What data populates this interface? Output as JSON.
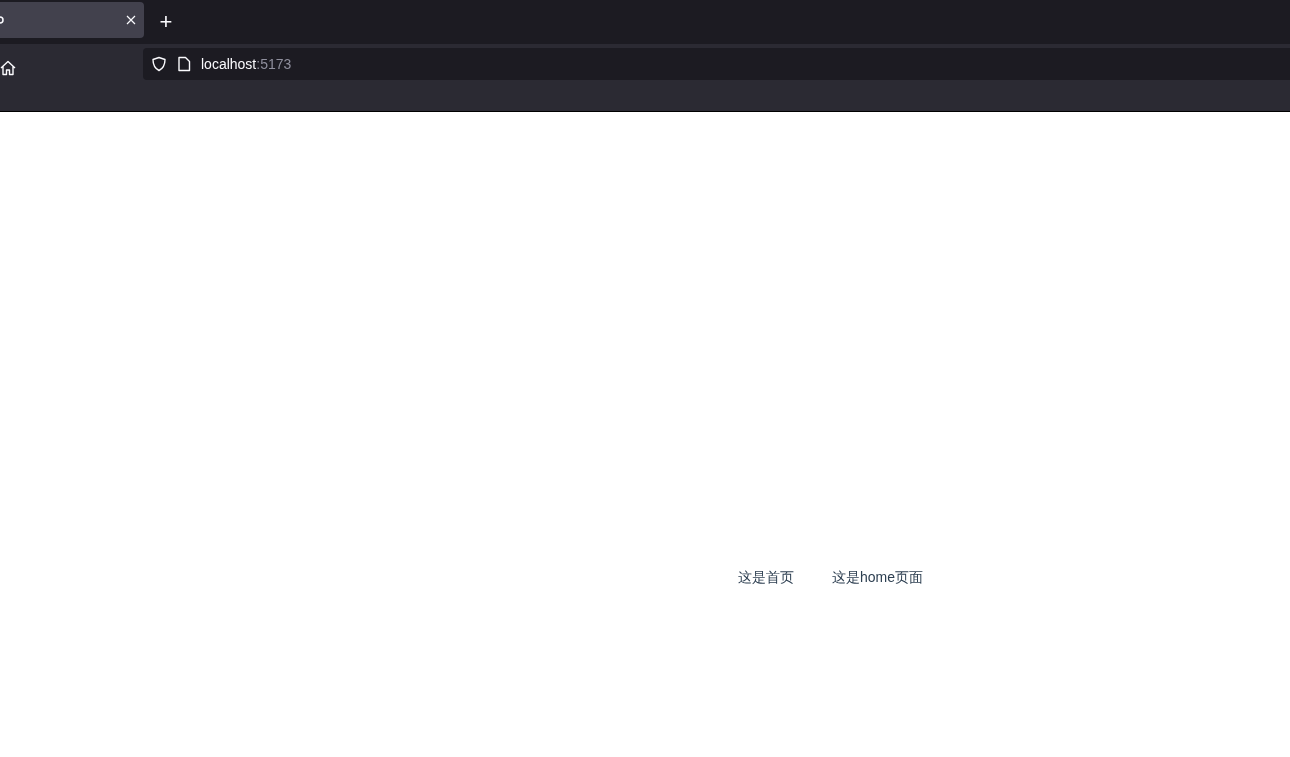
{
  "browser": {
    "new_tab_label": "+",
    "address": {
      "host": "localhost",
      "port": ":5173"
    }
  },
  "page": {
    "texts": [
      "这是首页",
      "这是home页面"
    ]
  }
}
